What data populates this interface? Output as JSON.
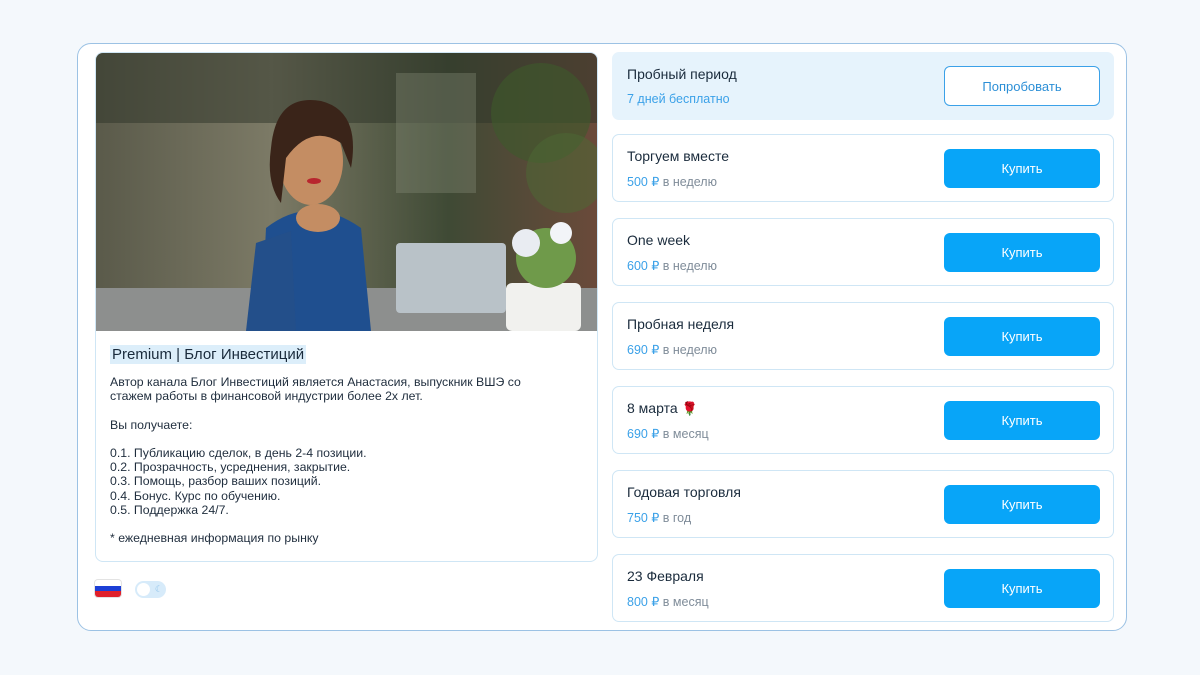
{
  "channel": {
    "title": "Premium | Блог Инвестиций",
    "description": "Автор канала Блог Инвестиций является Анастасия, выпускник ВШЭ со\nстажем работы в финансовой индустрии более 2х лет.\n\nВы получаете:\n\n0.1. Публикацию сделок, в день 2-4 позиции.\n0.2. Прозрачность, усреднения, закрытие.\n0.3. Помощь, разбор ваших позиций.\n0.4. Бонус. Курс по обучению.\n0.5. Поддержка 24/7.\n\n* ежедневная информация по рынку",
    "photo_icon": "woman-at-laptop-photo"
  },
  "language": {
    "flag_icon": "russia-flag-icon",
    "colors": [
      "#ffffff",
      "#1c3fd6",
      "#e0202b"
    ]
  },
  "theme_toggle": {
    "icon": "moon-icon",
    "state": "off"
  },
  "trial": {
    "name": "Пробный период",
    "subtitle": "7 дней бесплатно",
    "button": "Попробовать"
  },
  "plans": [
    {
      "name": "Торгуем вместе",
      "price": "500 ₽",
      "period": "в неделю",
      "button": "Купить"
    },
    {
      "name": "One week",
      "price": "600 ₽",
      "period": "в неделю",
      "button": "Купить"
    },
    {
      "name": "Пробная неделя",
      "price": "690 ₽",
      "period": "в неделю",
      "button": "Купить"
    },
    {
      "name": "8 марта",
      "emoji": "🌹",
      "price": "690 ₽",
      "period": "в месяц",
      "button": "Купить"
    },
    {
      "name": "Годовая торговля",
      "price": "750 ₽",
      "period": "в год",
      "button": "Купить"
    },
    {
      "name": "23 Февраля",
      "price": "800 ₽",
      "period": "в месяц",
      "button": "Купить"
    }
  ],
  "colors": {
    "accent": "#08a5f8",
    "price": "#3ba1e8",
    "trial_bg": "#e6f3fc",
    "border": "#cfe6f5"
  }
}
